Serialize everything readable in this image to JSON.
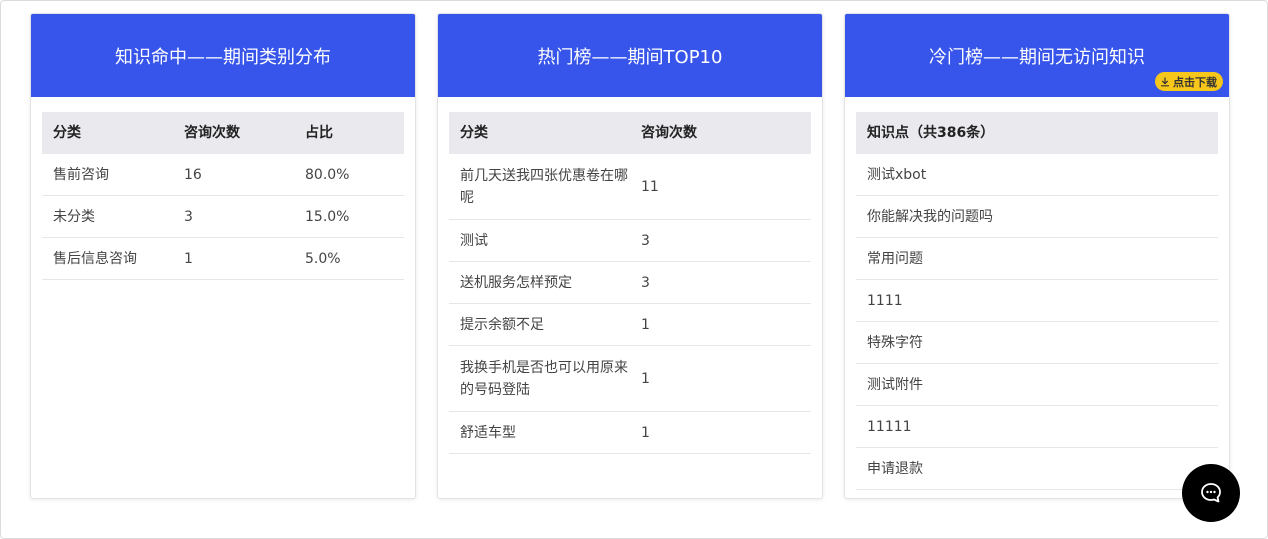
{
  "cards": {
    "category": {
      "title": "知识命中——期间类别分布",
      "headers": [
        "分类",
        "咨询次数",
        "占比"
      ],
      "rows": [
        [
          "售前咨询",
          "16",
          "80.0%"
        ],
        [
          "未分类",
          "3",
          "15.0%"
        ],
        [
          "售后信息咨询",
          "1",
          "5.0%"
        ]
      ]
    },
    "top10": {
      "title": "热门榜——期间TOP10",
      "headers": [
        "分类",
        "咨询次数"
      ],
      "rows": [
        [
          "前几天送我四张优惠卷在哪呢",
          "11"
        ],
        [
          "测试",
          "3"
        ],
        [
          "送机服务怎样预定",
          "3"
        ],
        [
          "提示余额不足",
          "1"
        ],
        [
          "我换手机是否也可以用原来的号码登陆",
          "1"
        ],
        [
          "舒适车型",
          "1"
        ]
      ]
    },
    "cold": {
      "title": "冷门榜——期间无访问知识",
      "download_label": "点击下载",
      "headers": [
        "知识点（共386条）"
      ],
      "rows": [
        "测试xbot",
        "你能解决我的问题吗",
        "常用问题",
        "1111",
        "特殊字符",
        "测试附件",
        "11111",
        "申请退款"
      ]
    }
  },
  "icons": {
    "download": "download-icon",
    "chat": "chat-bubble-icon"
  },
  "colors": {
    "header_blue": "#3755ea",
    "download_yellow": "#f6c61b",
    "fab_black": "#000000"
  }
}
